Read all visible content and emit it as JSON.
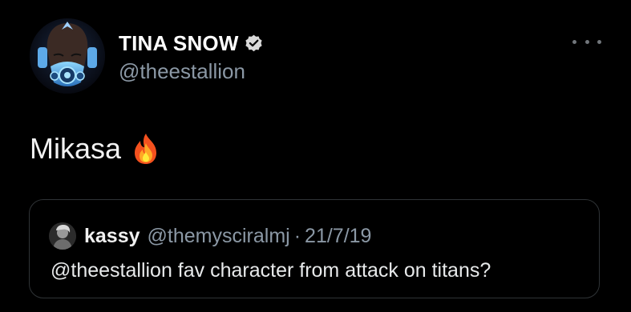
{
  "tweet": {
    "display_name": "TINA SNOW",
    "handle": "@theestallion",
    "verified": true,
    "text": "Mikasa",
    "emoji": "fire-icon",
    "menu_icon": "more-icon"
  },
  "quote": {
    "display_name": "kassy",
    "handle": "@themysciralmj",
    "separator": "·",
    "date": "21/7/19",
    "text": "@theestallion fav character from attack on titans?"
  },
  "colors": {
    "background": "#000000",
    "primary_text": "#e7e9ea",
    "secondary_text": "#8b98a5",
    "border": "#2f3336"
  }
}
